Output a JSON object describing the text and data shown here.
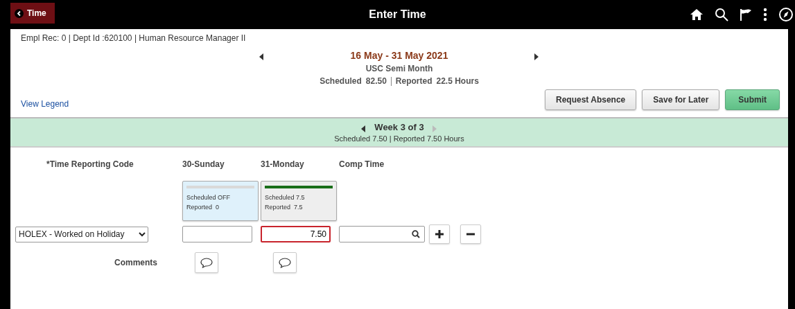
{
  "header": {
    "back_label": "Time",
    "title": "Enter Time"
  },
  "job_info": "Empl Rec: 0 | Dept Id :620100 | Human Resource Manager II",
  "period": {
    "range": "16 May - 31 May 2021",
    "schedule": "USC Semi Month",
    "scheduled_label": "Scheduled",
    "scheduled_value": "82.50",
    "reported_label": "Reported",
    "reported_value": "22.5 Hours"
  },
  "view_legend": "View Legend",
  "buttons": [
    {
      "label": "Request Absence",
      "kind": "secondary"
    },
    {
      "label": "Save for Later",
      "kind": "secondary"
    },
    {
      "label": "Submit",
      "kind": "primary"
    }
  ],
  "week": {
    "label": "Week 3 of 3",
    "summary": "Scheduled 7.50 | Reported 7.50 Hours",
    "prev_disabled": false,
    "next_disabled": true
  },
  "code_header": "*Time Reporting Code",
  "days": [
    {
      "label": "30-Sunday",
      "scheduled": "Scheduled OFF",
      "reported": "Reported  0",
      "selected": true,
      "color": "#d9d9d9",
      "error": false
    },
    {
      "label": "31-Monday",
      "scheduled": "Scheduled 7.5",
      "reported": "Reported  7.5",
      "selected": false,
      "color": "#1a6e1a",
      "value": "7.50",
      "error": true
    }
  ],
  "comp_header": "Comp Time",
  "code_value": "HOLEX - Worked on Holiday",
  "comments_label": "Comments"
}
